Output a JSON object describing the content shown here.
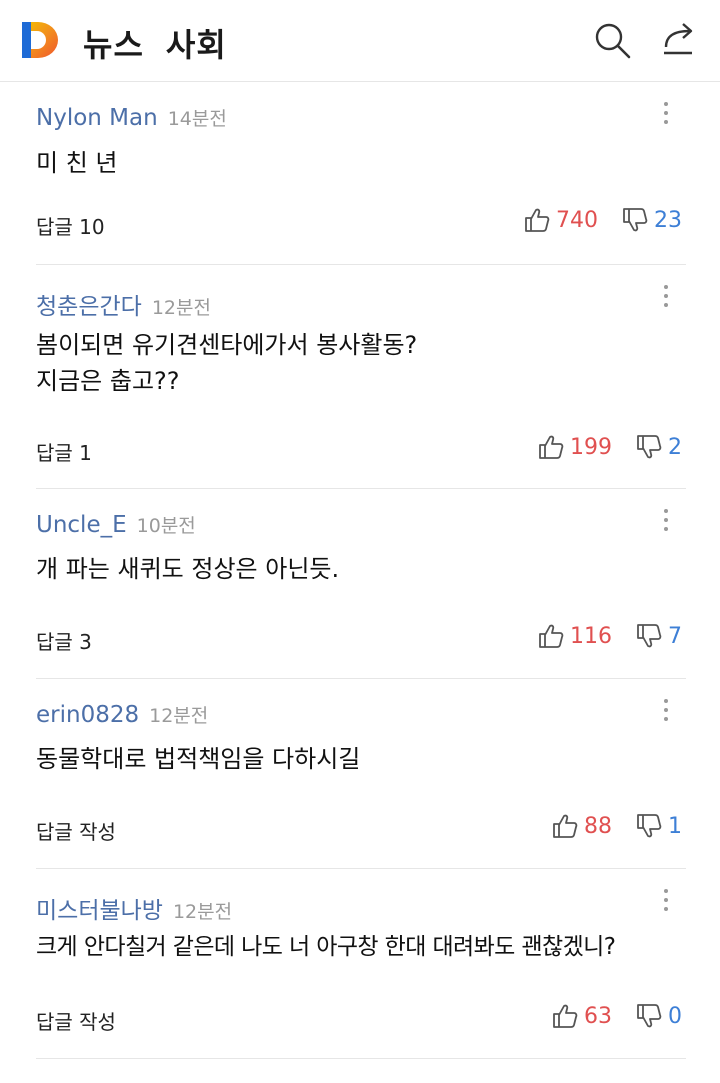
{
  "header": {
    "section": "뉴스",
    "category": "사회",
    "logo_colors": [
      "#1e6bd6",
      "#f2c200",
      "#f0562e"
    ]
  },
  "comments": [
    {
      "author": "Nylon Man",
      "time": "14분전",
      "text": "미 친 년",
      "reply": "답글 10",
      "likes": "740",
      "dislikes": "23"
    },
    {
      "author": "청춘은간다",
      "time": "12분전",
      "text": "봄이되면 유기견센타에가서 봉사활동?\n지금은 춥고??",
      "reply": "답글 1",
      "likes": "199",
      "dislikes": "2"
    },
    {
      "author": "Uncle_E",
      "time": "10분전",
      "text": "개 파는 새퀴도 정상은 아닌듯.",
      "reply": "답글 3",
      "likes": "116",
      "dislikes": "7"
    },
    {
      "author": "erin0828",
      "time": "12분전",
      "text": "동물학대로 법적책임을 다하시길",
      "reply": "답글 작성",
      "likes": "88",
      "dislikes": "1"
    },
    {
      "author": "미스터불나방",
      "time": "12분전",
      "text": "크게 안다칠거 같은데 나도 너 아구창 한대 대려봐도 괜찮겠니?",
      "reply": "답글 작성",
      "likes": "63",
      "dislikes": "0"
    }
  ],
  "colors": {
    "author": "#4c6fa8",
    "like": "#e05050",
    "dislike": "#3d7fd6"
  }
}
